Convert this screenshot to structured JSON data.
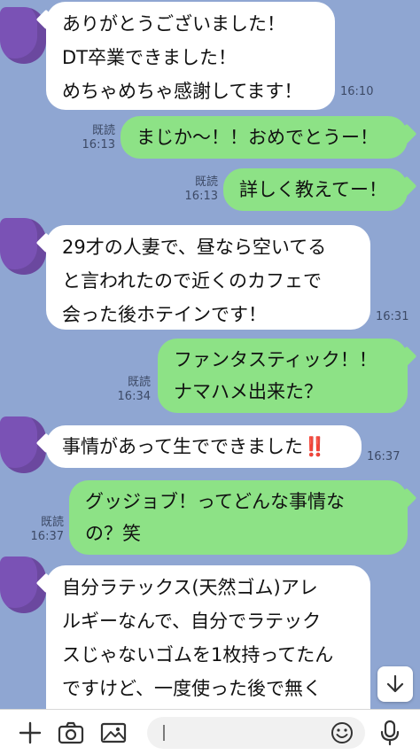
{
  "messages": [
    {
      "side": "in",
      "text": "ありがとうございました！\nDT卒業できました！\nめちゃめちゃ感謝してます！",
      "time": "16:10"
    },
    {
      "side": "out",
      "text": "まじか〜！！おめでとうー！",
      "read": "既読",
      "time": "16:13"
    },
    {
      "side": "out",
      "text": "詳しく教えてー！",
      "read": "既読",
      "time": "16:13"
    },
    {
      "side": "in",
      "text": "29才の人妻で、昼なら空いてる\nと言われたので近くのカフェで\n会った後ホテインです！",
      "time": "16:31"
    },
    {
      "side": "out",
      "text": "ファンタスティック！！\nナマハメ出来た？",
      "read": "既読",
      "time": "16:34"
    },
    {
      "side": "in",
      "text": "事情があって生でできました‼️",
      "time": "16:37"
    },
    {
      "side": "out",
      "text": "グッジョブ！ってどんな事情な\nの？笑",
      "read": "既読",
      "time": "16:37"
    },
    {
      "side": "in",
      "text": "自分ラテックス(天然ゴム)アレ\nルギーなんで、自分でラテック\nスじゃないゴムを1枚持ってたん\nですけど、一度使った後で無く\nなった後も勃っててゴムつける",
      "time": ""
    }
  ],
  "composer": {
    "placeholder": "",
    "icons": [
      "plus-icon",
      "camera-icon",
      "image-icon",
      "emoji-icon",
      "microphone-icon"
    ]
  },
  "scroll_button_icon": "arrow-down-icon"
}
